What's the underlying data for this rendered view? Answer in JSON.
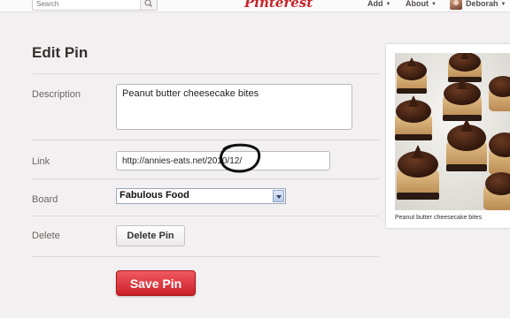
{
  "header": {
    "search_placeholder": "Search",
    "logo": "Pinterest",
    "nav_add": "Add",
    "nav_about": "About",
    "user_name": "Deborah"
  },
  "form": {
    "title": "Edit Pin",
    "description_label": "Description",
    "description_value": "Peanut butter cheesecake bites",
    "link_label": "Link",
    "link_value": "http://annies-eats.net/2010/12/",
    "board_label": "Board",
    "board_value": "Fabulous Food",
    "delete_label": "Delete",
    "delete_button": "Delete Pin",
    "save_button": "Save Pin"
  },
  "preview": {
    "caption": "Peanut butter cheesecake bites"
  },
  "colors": {
    "brand_red": "#cc2028",
    "background": "#f2f0f0",
    "annotation_circle": "#111111"
  }
}
